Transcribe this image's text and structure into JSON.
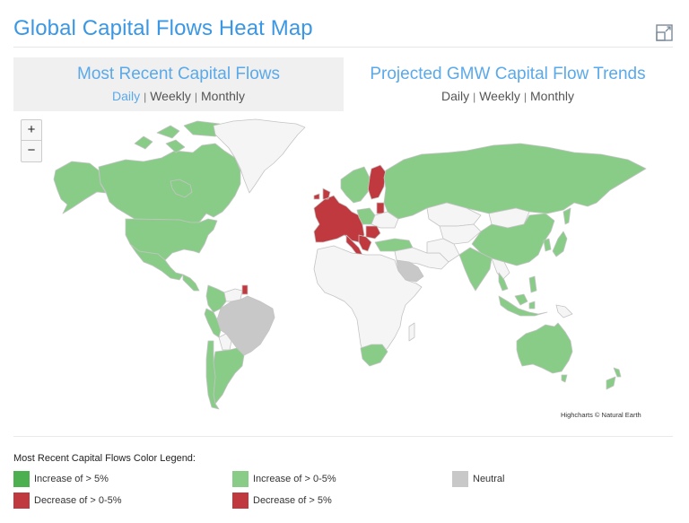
{
  "header": {
    "title": "Global Capital Flows Heat Map",
    "expand_icon": "expand-icon"
  },
  "tabs": [
    {
      "label": "Most Recent Capital Flows",
      "active": true,
      "periods": [
        {
          "label": "Daily",
          "selected": true
        },
        {
          "label": "Weekly",
          "selected": false
        },
        {
          "label": "Monthly",
          "selected": false
        }
      ]
    },
    {
      "label": "Projected GMW Capital Flow Trends",
      "active": false,
      "periods": [
        {
          "label": "Daily",
          "selected": false
        },
        {
          "label": "Weekly",
          "selected": false
        },
        {
          "label": "Monthly",
          "selected": false
        }
      ]
    }
  ],
  "map": {
    "zoom_in": "+",
    "zoom_out": "−",
    "credits": "Highcharts © Natural Earth",
    "colors": {
      "increase_gt5": "#4caf50",
      "increase_0_5": "#88cc88",
      "neutral": "#c8c8c8",
      "decrease_0_5": "#c0393f",
      "decrease_gt5": "#c0393f",
      "no_data": "#f5f5f5",
      "border": "#c4c4c4"
    },
    "regions": [
      {
        "name": "Canada",
        "category": "increase_0_5"
      },
      {
        "name": "United States",
        "category": "increase_0_5"
      },
      {
        "name": "Alaska",
        "category": "increase_0_5"
      },
      {
        "name": "Mexico",
        "category": "increase_0_5"
      },
      {
        "name": "Greenland",
        "category": "no_data"
      },
      {
        "name": "Colombia",
        "category": "increase_0_5"
      },
      {
        "name": "Peru",
        "category": "increase_0_5"
      },
      {
        "name": "Brazil",
        "category": "neutral"
      },
      {
        "name": "Argentina",
        "category": "increase_0_5"
      },
      {
        "name": "Chile",
        "category": "increase_0_5"
      },
      {
        "name": "French Guiana",
        "category": "decrease_0_5"
      },
      {
        "name": "Western Europe",
        "category": "decrease_0_5"
      },
      {
        "name": "Finland",
        "category": "decrease_0_5"
      },
      {
        "name": "Scandinavia",
        "category": "increase_0_5"
      },
      {
        "name": "Poland",
        "category": "increase_0_5"
      },
      {
        "name": "Romania",
        "category": "decrease_0_5"
      },
      {
        "name": "Turkey",
        "category": "increase_0_5"
      },
      {
        "name": "Russia",
        "category": "increase_0_5"
      },
      {
        "name": "Saudi Arabia",
        "category": "neutral"
      },
      {
        "name": "Africa",
        "category": "no_data"
      },
      {
        "name": "South Africa",
        "category": "increase_0_5"
      },
      {
        "name": "India",
        "category": "increase_0_5"
      },
      {
        "name": "China",
        "category": "increase_0_5"
      },
      {
        "name": "Japan",
        "category": "increase_0_5"
      },
      {
        "name": "Indonesia",
        "category": "increase_0_5"
      },
      {
        "name": "Australia",
        "category": "increase_0_5"
      },
      {
        "name": "New Zealand",
        "category": "increase_0_5"
      }
    ]
  },
  "legend": {
    "title": "Most Recent Capital Flows Color Legend:",
    "items": [
      {
        "label": "Increase of > 5%",
        "color": "#4caf50"
      },
      {
        "label": "Increase of > 0-5%",
        "color": "#88cc88"
      },
      {
        "label": "Neutral",
        "color": "#c8c8c8"
      },
      {
        "label": "Decrease of > 0-5%",
        "color": "#c0393f"
      },
      {
        "label": "Decrease of > 5%",
        "color": "#c0393f"
      }
    ]
  }
}
